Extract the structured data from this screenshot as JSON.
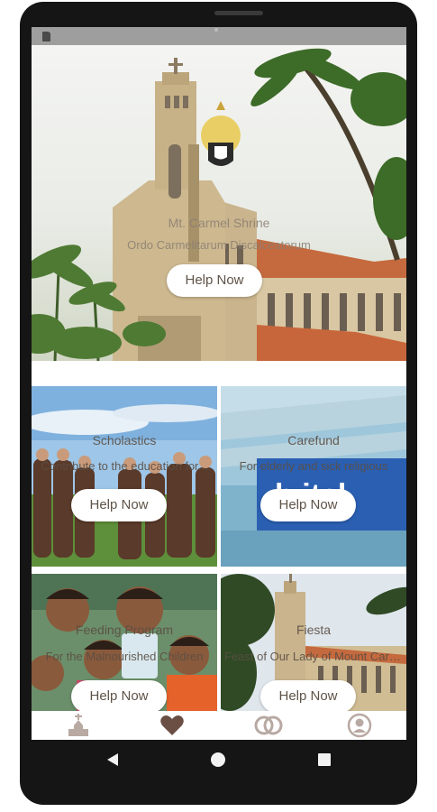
{
  "hero": {
    "title": "Mt. Carmel Shrine",
    "subtitle": "Ordo Carmelitarum Discalceatorum",
    "help_label": "Help Now"
  },
  "cards": [
    {
      "title": "Scholastics",
      "subtitle": "Contribute to the education for...",
      "help_label": "Help Now"
    },
    {
      "title": "Carefund",
      "subtitle": "For elderly and sick religious",
      "help_label": "Help Now"
    },
    {
      "title": "Feeding Program",
      "subtitle": "For the Malnourished Children",
      "help_label": "Help Now"
    },
    {
      "title": "Fiesta",
      "subtitle": "Feast of Our Lady of Mount Carmel",
      "help_label": "Help Now"
    }
  ],
  "nav": {
    "items": [
      "church-icon",
      "heart-icon",
      "rings-icon",
      "profile-icon"
    ],
    "active_color": "#6b4f45",
    "inactive_color": "#b8a9a2"
  },
  "colors": {
    "accent": "#6b4f45",
    "status_bar": "#9e9e9e"
  }
}
